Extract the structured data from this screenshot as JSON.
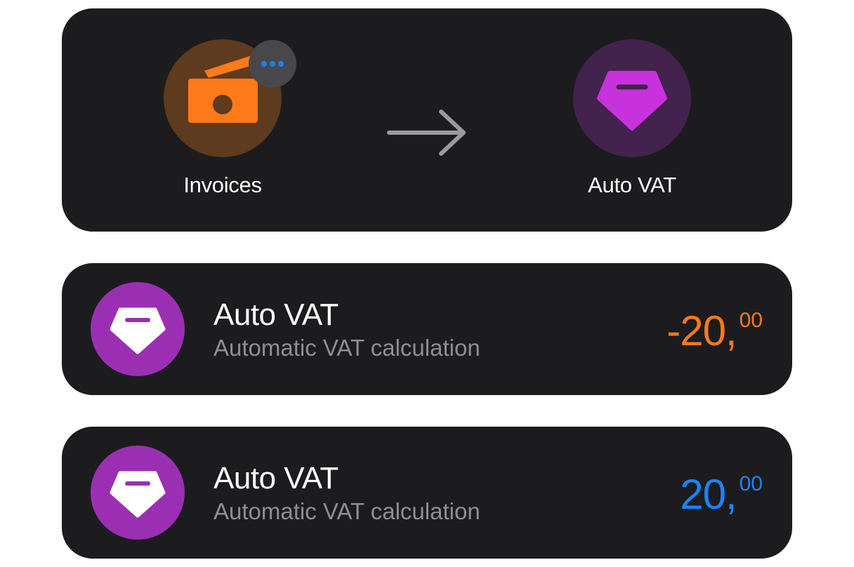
{
  "flow": {
    "source": {
      "label": "Invoices",
      "icon": "wallet-icon",
      "badge_icon": "more-dots-icon"
    },
    "arrow_icon": "arrow-right-icon",
    "target": {
      "label": "Auto VAT",
      "icon": "diamond-icon"
    }
  },
  "transactions": [
    {
      "title": "Auto VAT",
      "subtitle": "Automatic VAT calculation",
      "amount_main": "-20,",
      "amount_cents": "00",
      "icon": "diamond-icon"
    },
    {
      "title": "Auto VAT",
      "subtitle": "Automatic VAT calculation",
      "amount_main": "20,",
      "amount_cents": "00",
      "icon": "diamond-icon"
    }
  ],
  "colors": {
    "card_background": "#1c1c1e",
    "invoices_icon_bg": "#5e3a1e",
    "invoices_icon_fg": "#ff7a1a",
    "auto_vat_icon_bg": "#43224d",
    "auto_vat_icon_fg": "#c832dc",
    "row_icon_bg": "#9b2fb4",
    "negative_amount": "#ff7a1a",
    "positive_amount": "#1a84ff",
    "badge_dots": "#1a84ff"
  }
}
